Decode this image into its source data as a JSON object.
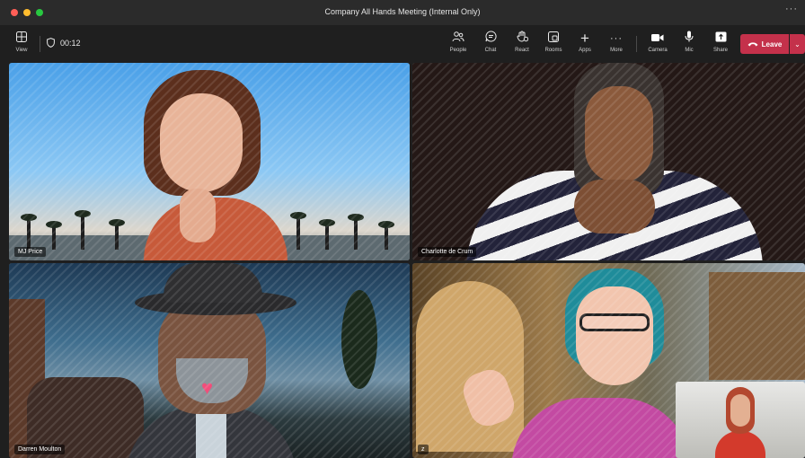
{
  "window": {
    "title": "Company All Hands Meeting (Internal Only)",
    "more_glyph": "···"
  },
  "toolbar": {
    "view_label": "View",
    "timer": "00:12",
    "people_label": "People",
    "chat_label": "Chat",
    "react_label": "React",
    "rooms_label": "Rooms",
    "apps_label": "Apps",
    "more_label": "More",
    "camera_label": "Camera",
    "mic_label": "Mic",
    "share_label": "Share",
    "leave_label": "Leave",
    "more_glyph": "···",
    "plus_glyph": "+",
    "chevron_glyph": "⌄"
  },
  "tiles": [
    {
      "name": "MJ Price"
    },
    {
      "name": "Charlotte de Crum"
    },
    {
      "name": "Darren Moulton"
    },
    {
      "name": "z"
    }
  ],
  "colors": {
    "leave": "#c4314b",
    "toolbar_bg": "#1f1f1f",
    "titlebar_bg": "#2b2b2b"
  }
}
